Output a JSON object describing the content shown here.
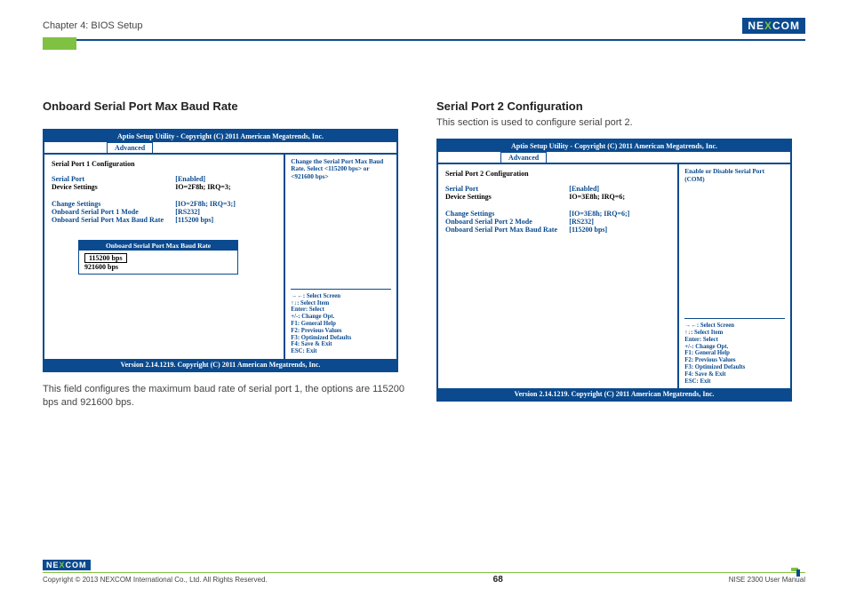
{
  "header": {
    "chapter": "Chapter 4: BIOS Setup",
    "brand_pre": "NE",
    "brand_x": "X",
    "brand_post": "COM"
  },
  "left": {
    "title": "Onboard Serial Port Max Baud Rate",
    "bios_title": "Aptio Setup Utility - Copyright (C) 2011 American Megatrends, Inc.",
    "tab": "Advanced",
    "cfg_title": "Serial Port 1 Configuration",
    "rows": [
      {
        "label": "Serial Port",
        "value": "[Enabled]",
        "labelClass": "blue",
        "valClass": "blue"
      },
      {
        "label": "Device Settings",
        "value": "IO=2F8h; IRQ=3;",
        "labelClass": "black",
        "valClass": "black"
      }
    ],
    "rows2": [
      {
        "label": "Change Settings",
        "value": "[IO=2F8h; IRQ=3;]",
        "labelClass": "blue",
        "valClass": "blue"
      },
      {
        "label": "Onboard Serial Port 1 Mode",
        "value": "[RS232]",
        "labelClass": "blue",
        "valClass": "blue"
      },
      {
        "label": "Onboard Serial Port Max Baud Rate",
        "value": "[115200 bps]",
        "labelClass": "blue",
        "valClass": "blue"
      }
    ],
    "popup_title": "Onboard Serial Port Max Baud Rate",
    "popup_sel": "115200 bps",
    "popup_opt": "921600 bps",
    "help_top": "Change the Serial Port Max Baud Rate. Select <115200 bps> or <921600 bps>",
    "keys": [
      "→←: Select Screen",
      "↑↓: Select Item",
      "Enter: Select",
      "+/-: Change Opt.",
      "F1: General Help",
      "F2: Previous Values",
      "F3: Optimized Defaults",
      "F4: Save & Exit",
      "ESC: Exit"
    ],
    "bios_footer": "Version 2.14.1219. Copyright (C) 2011 American Megatrends, Inc.",
    "caption": "This field configures the maximum baud rate of serial port 1, the options are 115200 bps and 921600 bps."
  },
  "right": {
    "title": "Serial Port 2 Configuration",
    "desc": "This section is used to configure serial port 2.",
    "bios_title": "Aptio Setup Utility - Copyright (C) 2011 American Megatrends, Inc.",
    "tab": "Advanced",
    "cfg_title": "Serial Port 2 Configuration",
    "rows": [
      {
        "label": "Serial Port",
        "value": "[Enabled]",
        "labelClass": "blue",
        "valClass": "blue"
      },
      {
        "label": "Device Settings",
        "value": "IO=3E8h; IRQ=6;",
        "labelClass": "black",
        "valClass": "black"
      }
    ],
    "rows2": [
      {
        "label": "Change Settings",
        "value": "[IO=3E8h; IRQ=6;]",
        "labelClass": "blue",
        "valClass": "blue"
      },
      {
        "label": "Onboard Serial Port 2 Mode",
        "value": "[RS232]",
        "labelClass": "blue",
        "valClass": "blue"
      },
      {
        "label": "Onboard Serial Port Max Baud Rate",
        "value": "[115200 bps]",
        "labelClass": "blue",
        "valClass": "blue"
      }
    ],
    "help_top": "Enable or Disable Serial Port (COM)",
    "keys": [
      "→←: Select Screen",
      "↑↓: Select Item",
      "Enter: Select",
      "+/-: Change Opt.",
      "F1: General Help",
      "F2: Previous Values",
      "F3: Optimized Defaults",
      "F4: Save & Exit",
      "ESC: Exit"
    ],
    "bios_footer": "Version 2.14.1219. Copyright (C) 2011 American Megatrends, Inc."
  },
  "footer": {
    "copyright": "Copyright © 2013 NEXCOM International Co., Ltd. All Rights Reserved.",
    "page": "68",
    "manual": "NISE 2300 User Manual"
  }
}
